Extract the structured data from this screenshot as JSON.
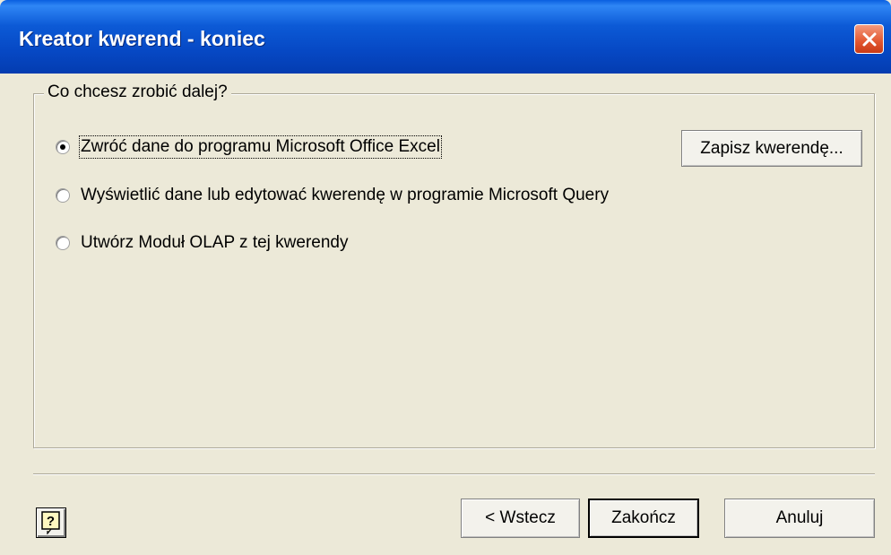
{
  "window": {
    "title": "Kreator kwerend - koniec"
  },
  "group": {
    "legend": "Co chcesz zrobić dalej?"
  },
  "options": [
    {
      "label": "Zwróć dane do programu Microsoft Office Excel",
      "selected": true
    },
    {
      "label": "Wyświetlić dane lub edytować kwerendę w programie Microsoft Query",
      "selected": false
    },
    {
      "label": "Utwórz Moduł OLAP z tej kwerendy",
      "selected": false
    }
  ],
  "buttons": {
    "save_query": "Zapisz kwerendę...",
    "back": "< Wstecz",
    "finish": "Zakończ",
    "cancel": "Anuluj"
  },
  "icons": {
    "close": "close-icon",
    "help": "help-icon"
  },
  "colors": {
    "titlebar": "#0648c4",
    "close": "#e2562f",
    "background": "#ece9d8"
  }
}
